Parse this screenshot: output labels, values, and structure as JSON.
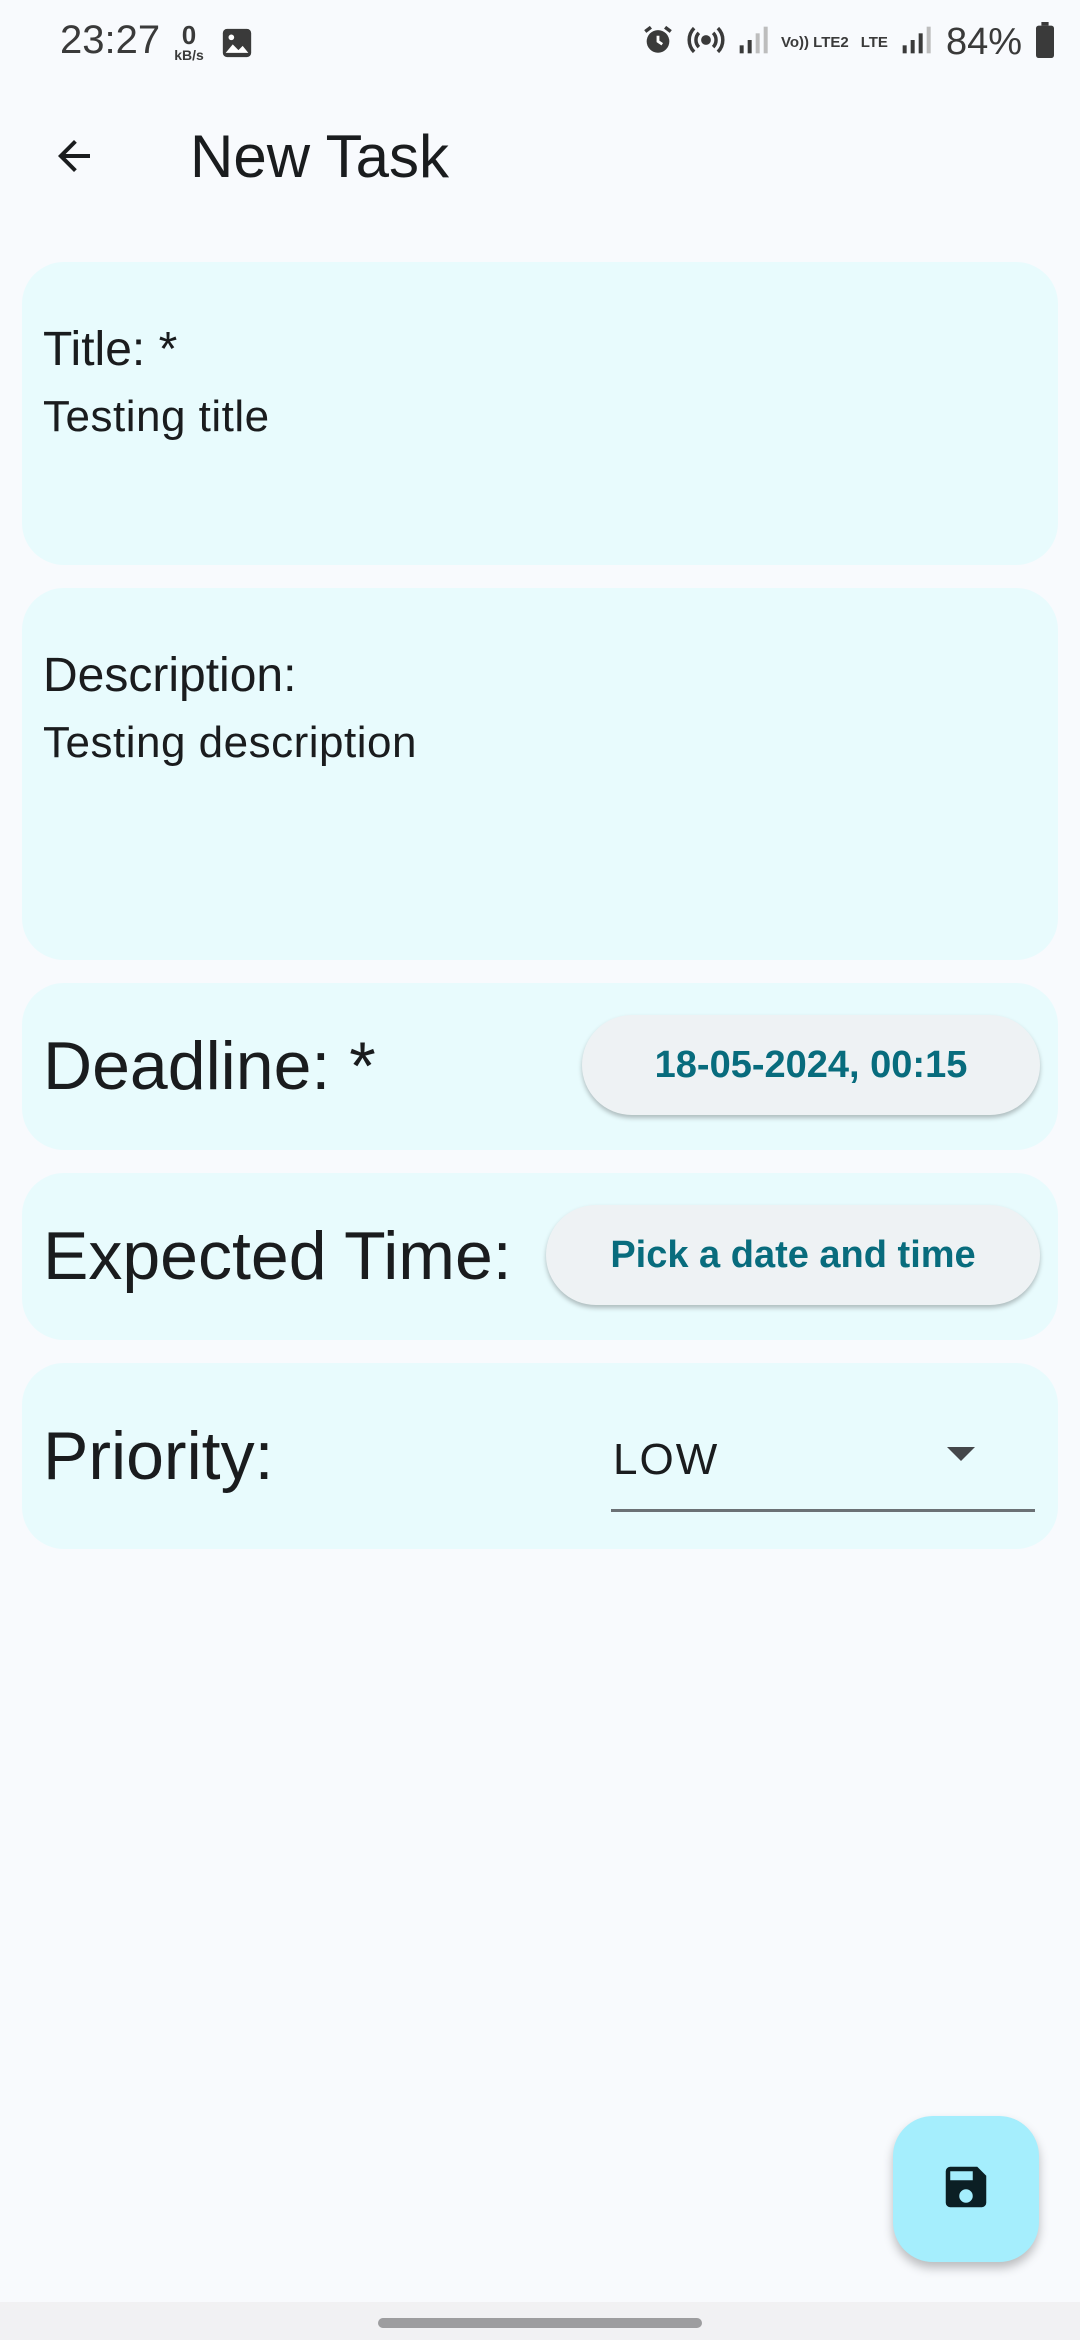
{
  "status_bar": {
    "time": "23:27",
    "net_speed_value": "0",
    "net_speed_unit": "kB/s",
    "network_labels": [
      "Vo)) LTE2",
      "LTE"
    ],
    "battery": "84%",
    "icons": [
      "gallery-icon",
      "alarm-icon",
      "hotspot-icon",
      "signal-icon",
      "signal-icon-2",
      "battery-icon"
    ]
  },
  "app_bar": {
    "title": "New Task",
    "back_icon": "arrow-back-icon"
  },
  "form": {
    "title_label": "Title: *",
    "title_value": "Testing title",
    "description_label": "Description:",
    "description_value": "Testing description",
    "deadline_label": "Deadline: *",
    "deadline_value": "18-05-2024, 00:15",
    "expected_label": "Expected Time:",
    "expected_value": "Pick a date and time",
    "priority_label": "Priority:",
    "priority_value": "LOW"
  },
  "fab": {
    "icon": "save-icon"
  },
  "colors": {
    "background": "#f8fafd",
    "card": "#e8fbfd",
    "accent_text": "#086c7d",
    "fab": "#a5eefd"
  }
}
